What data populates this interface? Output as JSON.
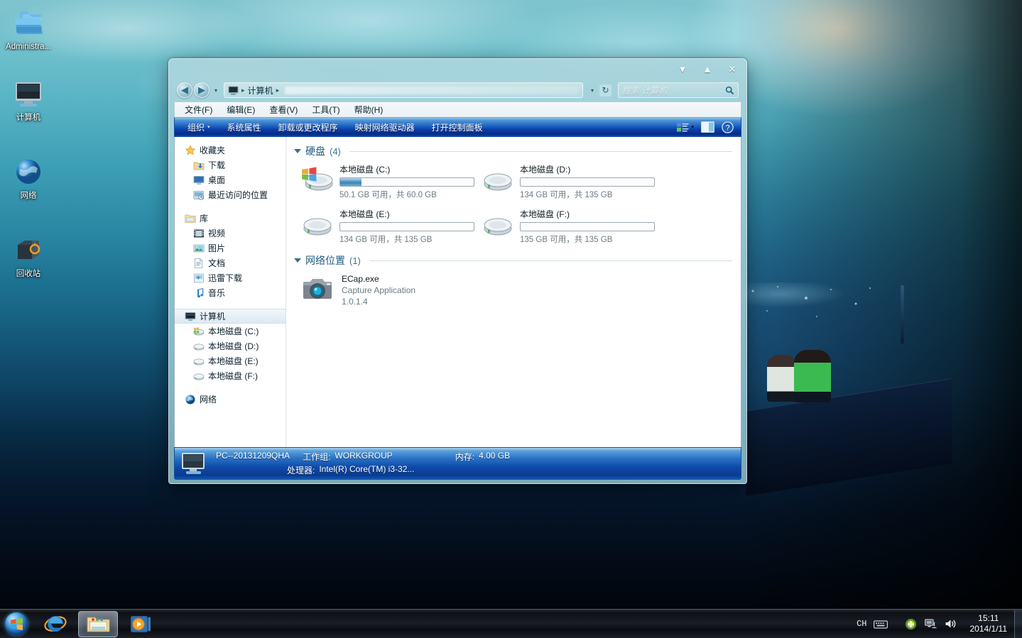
{
  "desktop": {
    "icons": [
      {
        "name": "administrator-folder",
        "label": "Administra...",
        "icon": "folder-icon"
      },
      {
        "name": "computer",
        "label": "计算机",
        "icon": "monitor-icon"
      },
      {
        "name": "network",
        "label": "网络",
        "icon": "globe-icon"
      },
      {
        "name": "recycle-bin",
        "label": "回收站",
        "icon": "recycle-bin-icon"
      }
    ]
  },
  "window": {
    "title_buttons": {
      "minimize": "▼",
      "maximize": "▲",
      "close": "✕"
    },
    "nav": {
      "back": "◀",
      "forward": "▶",
      "history_caret": "▾",
      "breadcrumb": [
        "计算机"
      ],
      "breadcrumb_sep": "▸",
      "recent_caret": "▾",
      "refresh": "↻"
    },
    "search": {
      "placeholder": "搜索 计算机",
      "icon": "search-icon"
    },
    "menubar": [
      "文件(F)",
      "编辑(E)",
      "查看(V)",
      "工具(T)",
      "帮助(H)"
    ],
    "commandbar": {
      "items": [
        "组织",
        "系统属性",
        "卸载或更改程序",
        "映射网络驱动器",
        "打开控制面板"
      ],
      "organize_caret": "▾",
      "view_caret": "▾",
      "icons": [
        "view-layout-icon",
        "preview-pane-icon",
        "help-icon"
      ]
    },
    "navpane": {
      "groups": [
        {
          "header": {
            "label": "收藏夹",
            "icon": "star-icon"
          },
          "items": [
            {
              "label": "下载",
              "icon": "downloads-icon"
            },
            {
              "label": "桌面",
              "icon": "desktop-icon"
            },
            {
              "label": "最近访问的位置",
              "icon": "recent-places-icon"
            }
          ]
        },
        {
          "header": {
            "label": "库",
            "icon": "library-icon"
          },
          "items": [
            {
              "label": "视频",
              "icon": "video-icon"
            },
            {
              "label": "图片",
              "icon": "pictures-icon"
            },
            {
              "label": "文档",
              "icon": "documents-icon"
            },
            {
              "label": "迅雷下载",
              "icon": "thunder-download-icon"
            },
            {
              "label": "音乐",
              "icon": "music-icon"
            }
          ]
        },
        {
          "header": {
            "label": "计算机",
            "icon": "computer-icon",
            "selected": true
          },
          "items": [
            {
              "label": "本地磁盘 (C:)",
              "icon": "system-drive-icon"
            },
            {
              "label": "本地磁盘 (D:)",
              "icon": "drive-icon"
            },
            {
              "label": "本地磁盘 (E:)",
              "icon": "drive-icon"
            },
            {
              "label": "本地磁盘 (F:)",
              "icon": "drive-icon"
            }
          ]
        },
        {
          "header": {
            "label": "网络",
            "icon": "network-globe-icon"
          },
          "items": []
        }
      ]
    },
    "content": {
      "hdd_group": {
        "title": "硬盘",
        "count": "(4)"
      },
      "drives": [
        {
          "name": "本地磁盘 (C:)",
          "capacity_text": "50.1 GB 可用，共 60.0 GB",
          "used_percent": 16,
          "system": true
        },
        {
          "name": "本地磁盘 (D:)",
          "capacity_text": "134 GB 可用，共 135 GB",
          "used_percent": 0,
          "system": false
        },
        {
          "name": "本地磁盘 (E:)",
          "capacity_text": "134 GB 可用，共 135 GB",
          "used_percent": 0,
          "system": false
        },
        {
          "name": "本地磁盘 (F:)",
          "capacity_text": "135 GB 可用，共 135 GB",
          "used_percent": 0,
          "system": false
        }
      ],
      "net_group": {
        "title": "网络位置",
        "count": "(1)"
      },
      "net_items": [
        {
          "name": "ECap.exe",
          "desc": "Capture Application",
          "version": "1.0.1.4",
          "icon": "camera-icon"
        }
      ]
    },
    "statusbar": {
      "computer_name": "PC--20131209QHA",
      "workgroup_label": "工作组:",
      "workgroup_value": "WORKGROUP",
      "memory_label": "内存:",
      "memory_value": "4.00 GB",
      "cpu_label": "处理器:",
      "cpu_value": "Intel(R) Core(TM) i3-32...",
      "icon": "computer-icon"
    }
  },
  "taskbar": {
    "start": "start-orb-icon",
    "items": [
      {
        "name": "internet-explorer",
        "icon": "ie-icon",
        "active": false
      },
      {
        "name": "windows-explorer",
        "icon": "explorer-folder-icon",
        "active": true
      },
      {
        "name": "media-player",
        "icon": "media-player-icon",
        "active": false
      }
    ],
    "tray": {
      "language": "CH",
      "keyboard_icon": "keyboard-icon",
      "icons": [
        "shield-update-icon",
        "network-icon",
        "volume-icon"
      ],
      "time": "15:11",
      "date": "2014/1/11"
    }
  },
  "colors": {
    "accent_blue": "#0b3ea8",
    "group_title": "#1f5d80",
    "drive_bar_blue": "#63a3cc",
    "window_glass": "#a8d3da"
  }
}
